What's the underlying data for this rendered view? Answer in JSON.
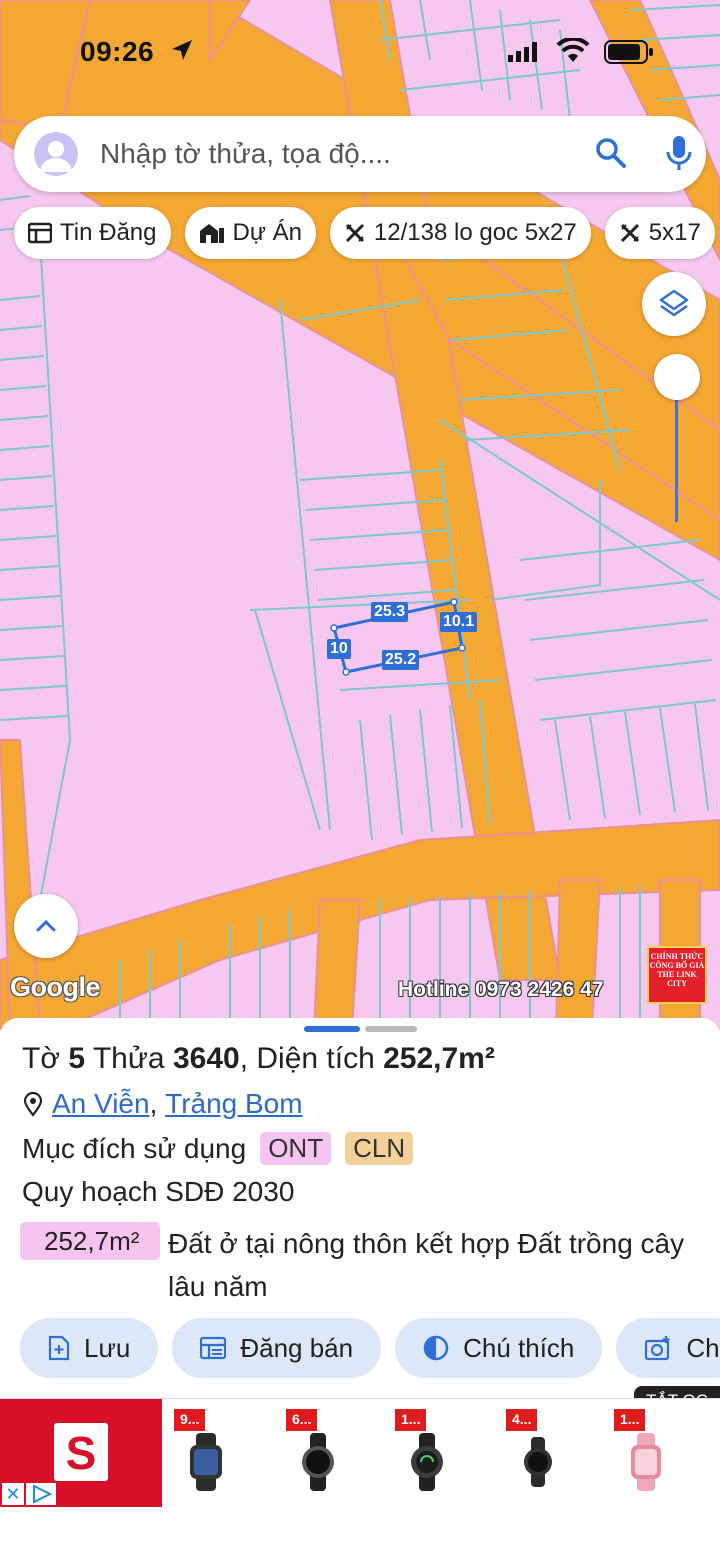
{
  "status_bar": {
    "time": "09:26"
  },
  "search": {
    "placeholder": "Nhập tờ thửa, tọa độ...."
  },
  "chips": [
    {
      "label": "Tin Đăng",
      "icon": "listing-icon"
    },
    {
      "label": "Dự Án",
      "icon": "building-icon"
    },
    {
      "label": "12/138 lo goc 5x27",
      "icon": "ruler-icon"
    },
    {
      "label": "5x17",
      "icon": "ruler-icon"
    }
  ],
  "map": {
    "google_label": "Google",
    "hotline": "Hotline 0973 2426 47",
    "badge_text": "CHÍNH THỨC CÔNG BỐ GIÁ THE LINK CITY",
    "dimensions": {
      "top": "25.3",
      "right": "10.1",
      "left": "10",
      "bottom": "25.2"
    }
  },
  "parcel": {
    "title_prefix": "Tờ",
    "sheet": "5",
    "plot_label": "Thửa",
    "plot": "3640",
    "area_label": ", Diện tích",
    "area": "252,7m²",
    "commune": "An Viễn",
    "district": "Trảng Bom",
    "purpose_label": "Mục đích sử dụng",
    "tags": [
      "ONT",
      "CLN"
    ],
    "plan_label": "Quy hoạch SDĐ 2030",
    "plan_area": "252,7m²",
    "plan_desc": "Đất ở tại nông thôn kết hợp Đất trồng cây lâu năm"
  },
  "actions": [
    {
      "label": "Lưu",
      "icon": "save-icon"
    },
    {
      "label": "Đăng bán",
      "icon": "listing-icon"
    },
    {
      "label": "Chú thích",
      "icon": "contrast-icon"
    },
    {
      "label": "Ch",
      "icon": "camera-icon"
    }
  ],
  "ad": {
    "hide_label": "TẮT QC",
    "brand_letter": "S",
    "products": [
      {
        "price": "9..."
      },
      {
        "price": "6..."
      },
      {
        "price": "1..."
      },
      {
        "price": "4..."
      },
      {
        "price": "1..."
      }
    ]
  },
  "colors": {
    "land": "#f6c8f0",
    "road": "#f5a733",
    "parcel_line": "#7ec7cf",
    "accent": "#2f6fd6"
  }
}
